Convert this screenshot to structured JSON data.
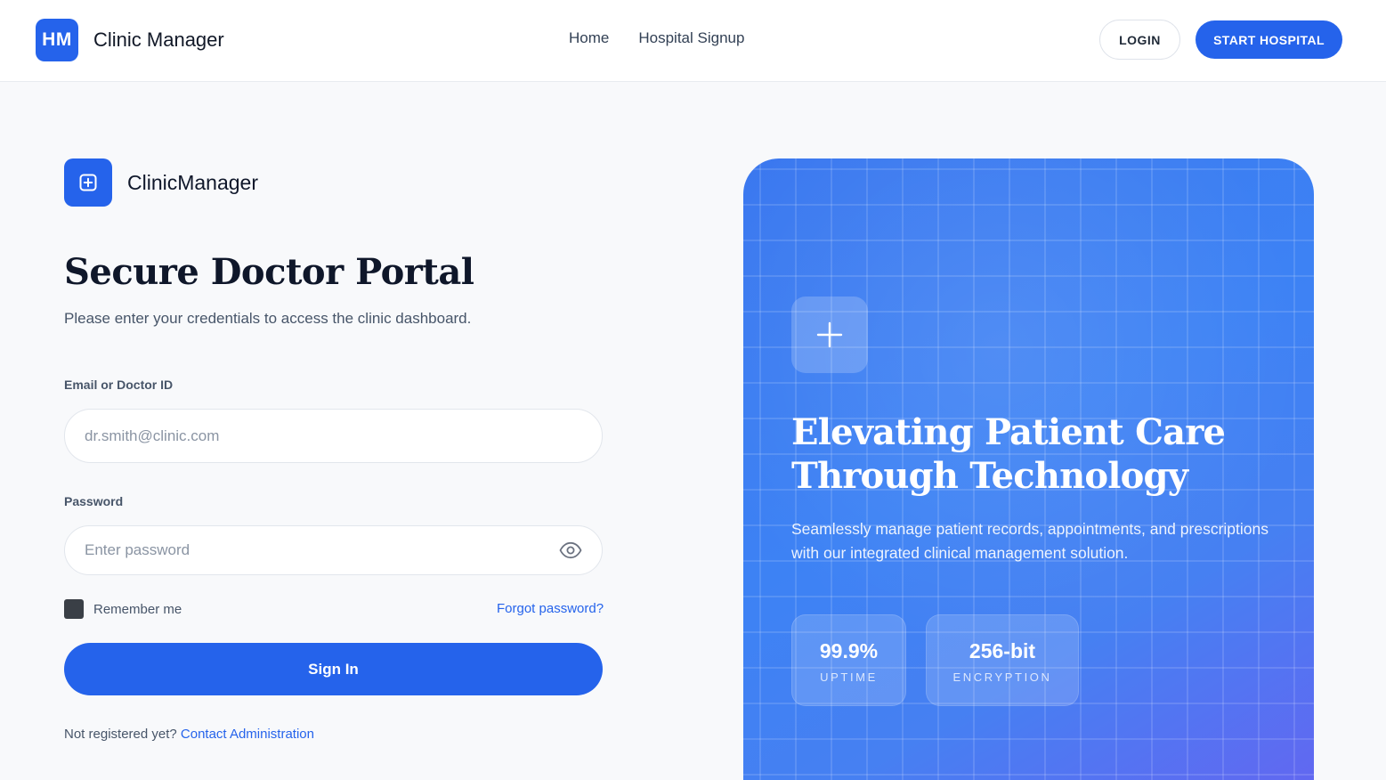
{
  "header": {
    "logo_initials": "HM",
    "app_name": "Clinic Manager",
    "nav": [
      {
        "label": "Home"
      },
      {
        "label": "Hospital Signup"
      }
    ],
    "login_label": "LOGIN",
    "start_label": "START HOSPITAL"
  },
  "login": {
    "brand_name": "ClinicManager",
    "title": "Secure Doctor Portal",
    "subtitle": "Please enter your credentials to access the clinic dashboard.",
    "email_label": "Email or Doctor ID",
    "email_placeholder": "dr.smith@clinic.com",
    "email_value": "",
    "password_label": "Password",
    "password_placeholder": "Enter password",
    "password_value": "",
    "remember_label": "Remember me",
    "remember_checked": true,
    "forgot_label": "Forgot password?",
    "signin_label": "Sign In",
    "register_prompt": "Not registered yet?",
    "register_link": "Contact Administration"
  },
  "hero": {
    "title": "Elevating Patient Care Through Technology",
    "description": "Seamlessly manage patient records, appointments, and prescriptions with our integrated clinical management solution.",
    "stats": [
      {
        "value": "99.9%",
        "label": "UPTIME"
      },
      {
        "value": "256-bit",
        "label": "ENCRYPTION"
      }
    ]
  },
  "icons": {
    "logo": "medical-plus-icon",
    "hero": "plus-icon",
    "password_toggle": "eye-icon"
  },
  "colors": {
    "primary": "#2563eb",
    "hero_gradient_start": "#3b78ef",
    "hero_gradient_end": "#6366f1"
  }
}
